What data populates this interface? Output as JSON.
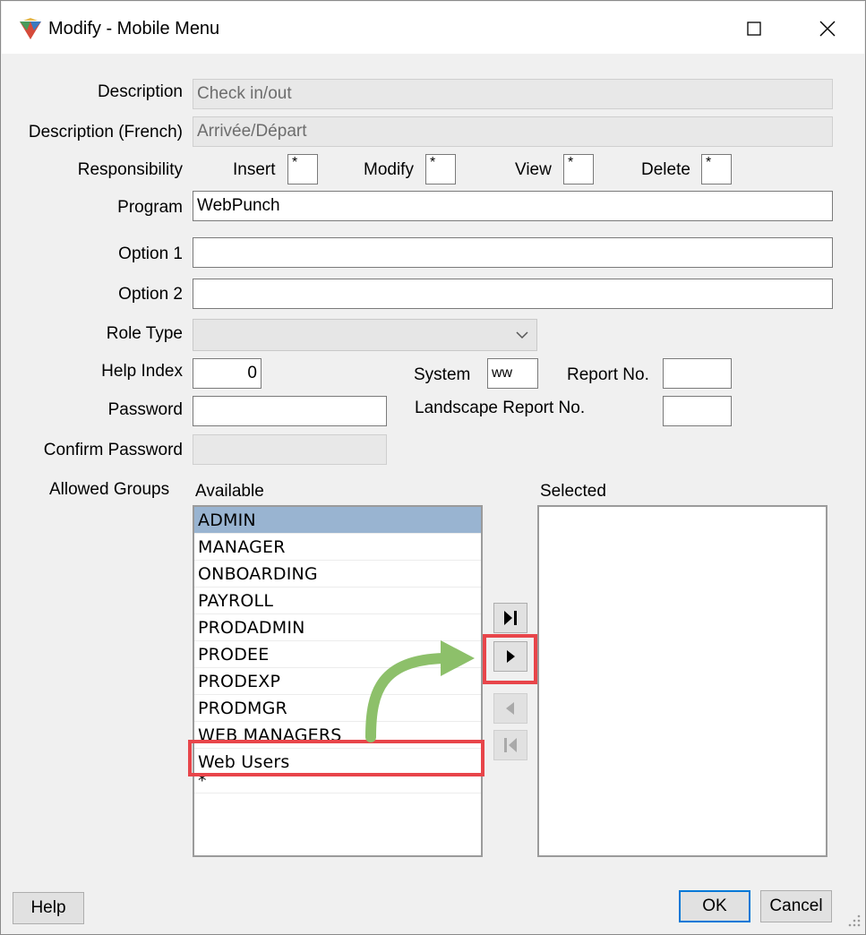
{
  "window": {
    "title": "Modify - Mobile Menu",
    "maximize_glyph": "☐",
    "close_glyph": "✕"
  },
  "form": {
    "description_label": "Description",
    "description_value": "Check in/out",
    "description_fr_label": "Description (French)",
    "description_fr_value": "Arrivée/Départ",
    "responsibility_label": "Responsibility",
    "insert_label": "Insert",
    "insert_value": "*",
    "modify_label": "Modify",
    "modify_value": "*",
    "view_label": "View",
    "view_value": "*",
    "delete_label": "Delete",
    "delete_value": "*",
    "program_label": "Program",
    "program_value": "WebPunch",
    "option1_label": "Option 1",
    "option1_value": "",
    "option2_label": "Option 2",
    "option2_value": "",
    "role_type_label": "Role Type",
    "role_type_value": "",
    "help_index_label": "Help Index",
    "help_index_value": "0",
    "system_label": "System",
    "system_value": "ww",
    "report_no_label": "Report No.",
    "report_no_value": "",
    "password_label": "Password",
    "password_value": "",
    "landscape_report_label": "Landscape Report No.",
    "landscape_report_value": "",
    "confirm_password_label": "Confirm Password",
    "confirm_password_value": ""
  },
  "groups": {
    "allowed_label": "Allowed Groups",
    "available_label": "Available",
    "selected_label": "Selected",
    "available_items": [
      "ADMIN",
      "MANAGER",
      "ONBOARDING",
      "PAYROLL",
      "PRODADMIN",
      "PRODEE",
      "PRODEXP",
      "PRODMGR",
      "WEB MANAGERS",
      "Web Users",
      "*"
    ],
    "selected_items": []
  },
  "buttons": {
    "help": "Help",
    "ok": "OK",
    "cancel": "Cancel"
  },
  "icons": {
    "app": "app-logo-icon",
    "move_all_right": "move-all-right-icon",
    "move_right": "move-right-icon",
    "move_left": "move-left-icon",
    "move_all_left": "move-all-left-icon",
    "annotation_arrow": "curved-arrow-icon"
  },
  "colors": {
    "selection": "#99b4d1",
    "highlight": "#e8454a",
    "annotation_arrow": "#8dc06a",
    "default_button_border": "#0078d7"
  }
}
